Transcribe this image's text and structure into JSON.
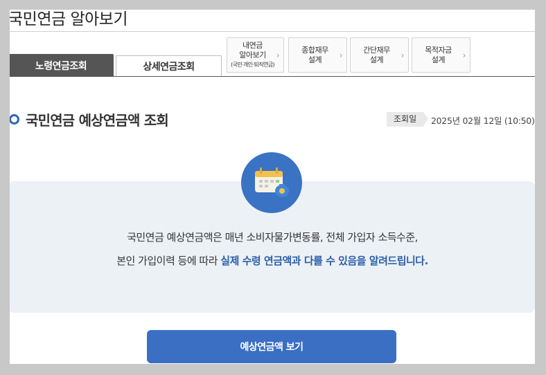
{
  "page": {
    "title": "국민연금 알아보기"
  },
  "tabs": [
    {
      "label": "노령연금조회",
      "active": true
    },
    {
      "label": "상세연금조회",
      "active": false
    }
  ],
  "sub_buttons": [
    {
      "line1": "내연금",
      "line2": "알아보기",
      "note": "(국민·개인·퇴직연금)"
    },
    {
      "line1": "종합재무",
      "line2": "설계"
    },
    {
      "line1": "간단재무",
      "line2": "설계"
    },
    {
      "line1": "목적자금",
      "line2": "설계"
    }
  ],
  "section": {
    "title": "국민연금 예상연금액 조회",
    "query_label": "조회일",
    "query_date": "2025년 02월 12일 (10:50)"
  },
  "info": {
    "icon": "calendar-money-icon",
    "line1": "국민연금 예상연금액은 매년 소비자물가변동률, 전체 가입자 소득수준,",
    "line2_plain": "본인 가입이력 등에 따라 ",
    "line2_highlight": "실제 수령 연금액과 다를 수 있음을 알려드립니다."
  },
  "actions": {
    "view_label": "예상연금액 보기"
  },
  "colors": {
    "accent": "#3a6fc4",
    "active_tab": "#555555",
    "info_bg": "#ecf1f6"
  }
}
